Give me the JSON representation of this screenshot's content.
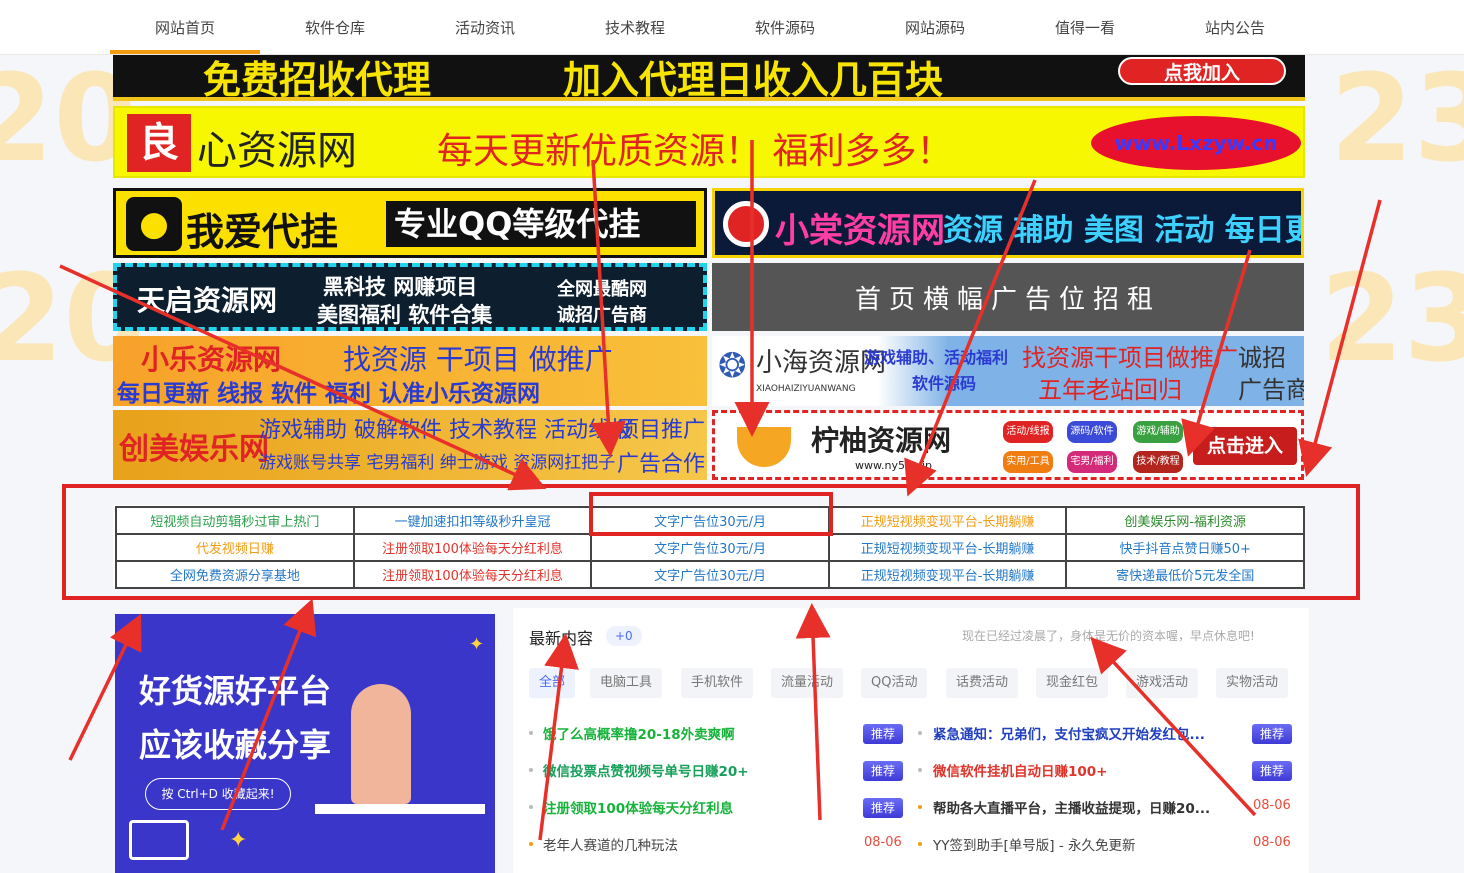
{
  "nav": [
    "网站首页",
    "软件仓库",
    "活动资讯",
    "技术教程",
    "软件源码",
    "网站源码",
    "值得一看",
    "站内公告"
  ],
  "banners": {
    "b1": {
      "left": "免费招收代理",
      "right": "加入代理日收入几百块",
      "btn": "点我加入"
    },
    "b2": {
      "logo": "良",
      "name": "心资源网",
      "slogan": "每天更新优质资源！ 福利多多！",
      "url": "www.Lxzyw.cn"
    },
    "b3": {
      "title": "我爱代挂",
      "desc": "专业QQ等级代挂"
    },
    "b4": {
      "title": "小棠资源网",
      "desc": "资源 辅助 美图 活动 每日更新"
    },
    "b5": {
      "title": "天启资源网",
      "t1": "黑科技 网赚项目",
      "t2": "美图福利 软件合集",
      "t3": "全网最酷网",
      "t4": "诚招广告商"
    },
    "b6": {
      "title": "首页横幅广告位招租"
    },
    "b7": {
      "title": "小乐资源网",
      "t1": "找资源 干项目 做推广",
      "t2": "每日更新 线报 软件 福利 认准小乐资源网"
    },
    "b8": {
      "title": "小海资源网",
      "sub": "XIAOHAIZIYUANWANG",
      "t1": "游戏辅助、活动福利",
      "t2": "软件源码",
      "t3": "找资源干项目做推广",
      "t4": "五年老站回归",
      "t5": "诚招",
      "t6": "广告商"
    },
    "b9": {
      "title": "创美娱乐网",
      "t1": "游戏辅助 破解软件 技术教程 活动线报",
      "t2": "游戏账号共享 宅男福利 绅士游戏 资源网扛把子",
      "t3": "项目推广",
      "t4": "广告合作"
    },
    "b10": {
      "title": "柠柚资源网",
      "url": "www.ny52.vip",
      "tags": [
        "活动/线报",
        "源码/软件",
        "游戏/辅助",
        "实用/工具",
        "宅男/福利",
        "技术/教程"
      ],
      "btn": "点击进入"
    }
  },
  "text_ads": [
    [
      {
        "t": "短视频自动剪辑秒过审上热门",
        "c": "#2aa14b"
      },
      {
        "t": "一键加速扣扣等级秒升皇冠",
        "c": "#2478c8"
      },
      {
        "t": "文字广告位30元/月",
        "c": "#2478c8"
      },
      {
        "t": "正规短视频变现平台-长期躺赚",
        "c": "#f39c12"
      },
      {
        "t": "创美娱乐网-福利资源",
        "c": "#2a8a2a"
      }
    ],
    [
      {
        "t": "代发视频日赚",
        "c": "#f39c12"
      },
      {
        "t": "注册领取100体验每天分红利息",
        "c": "#e0342c"
      },
      {
        "t": "文字广告位30元/月",
        "c": "#2478c8"
      },
      {
        "t": "正规短视频变现平台-长期躺赚",
        "c": "#2478c8"
      },
      {
        "t": "快手抖音点赞日赚50+",
        "c": "#2478c8"
      }
    ],
    [
      {
        "t": "全网免费资源分享基地",
        "c": "#2478c8"
      },
      {
        "t": "注册领取100体验每天分红利息",
        "c": "#e0342c"
      },
      {
        "t": "文字广告位30元/月",
        "c": "#2478c8"
      },
      {
        "t": "正规短视频变现平台-长期躺赚",
        "c": "#2478c8"
      },
      {
        "t": "寄快递最低价5元发全国",
        "c": "#2478c8"
      }
    ]
  ],
  "promo": {
    "line1": "好货源好平台",
    "line2": "应该收藏分享",
    "hint": "按 Ctrl+D 收藏起来!"
  },
  "latest": {
    "title": "最新内容",
    "count": "+0",
    "tip": "现在已经过凌晨了，身体是无价的资本喔，早点休息吧!",
    "tabs": [
      "全部",
      "电脑工具",
      "手机软件",
      "流量活动",
      "QQ活动",
      "话费活动",
      "现金红包",
      "游戏活动",
      "实物活动"
    ],
    "left": [
      {
        "t": "饿了么高概率撸20-18外卖爽啊",
        "badge": "推荐",
        "c": "#17b33b"
      },
      {
        "t": "微信投票点赞视频号单号日赚20+",
        "badge": "推荐",
        "c": "#17a05a"
      },
      {
        "t": "注册领取100体验每天分红利息",
        "badge": "推荐",
        "c": "#17b33b"
      },
      {
        "t": "老年人赛道的几种玩法",
        "date": "08-06",
        "c": "#444"
      }
    ],
    "right": [
      {
        "t": "紧急通知：兄弟们，支付宝疯又开始发红包...",
        "badge": "推荐",
        "c": "#1f3fbf"
      },
      {
        "t": "微信软件挂机自动日赚100+",
        "badge": "推荐",
        "c": "#e0342c"
      },
      {
        "t": "帮助各大直播平台，主播收益提现，日赚20...",
        "date": "08-06",
        "c": "#333"
      },
      {
        "t": "YY签到助手[单号版] - 永久免更新",
        "date": "08-06",
        "c": "#444"
      }
    ]
  },
  "colors": {
    "accent": "#f39c12",
    "frame": "#e02424"
  }
}
